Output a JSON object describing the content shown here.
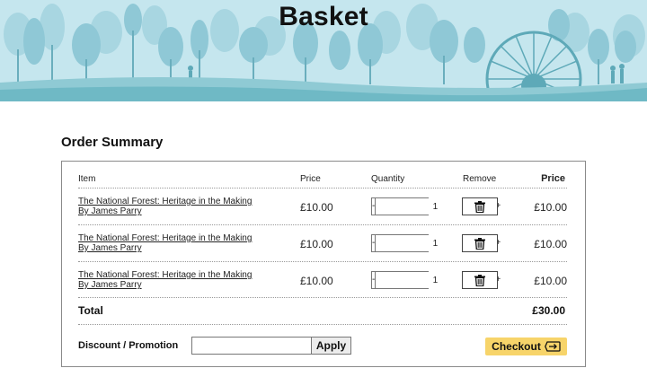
{
  "page": {
    "title": "Basket"
  },
  "colors": {
    "banner_sky": "#bfe3ec",
    "banner_ground": "#6fb9c5",
    "checkout": "#f7d46a"
  },
  "summary": {
    "title": "Order Summary",
    "headers": {
      "item": "Item",
      "price": "Price",
      "quantity": "Quantity",
      "remove": "Remove",
      "line_price": "Price"
    },
    "rows": [
      {
        "title": "The National Forest: Heritage in the Making",
        "author": "By James Parry",
        "unit_price": "£10.00",
        "quantity": "1",
        "line_price": "£10.00",
        "minus": "-",
        "plus": "+"
      },
      {
        "title": "The National Forest: Heritage in the Making",
        "author": "By James Parry",
        "unit_price": "£10.00",
        "quantity": "1",
        "line_price": "£10.00",
        "minus": "-",
        "plus": "+"
      },
      {
        "title": "The National Forest: Heritage in the Making",
        "author": "By James Parry",
        "unit_price": "£10.00",
        "quantity": "1",
        "line_price": "£10.00",
        "minus": "-",
        "plus": "+"
      }
    ],
    "total_label": "Total",
    "total_value": "£30.00",
    "discount_label": "Discount / Promotion",
    "discount_value": "",
    "apply_label": "Apply",
    "checkout_label": "Checkout",
    "checkout_icon": "ticket-arrow-icon",
    "remove_icon": "trash-icon"
  }
}
